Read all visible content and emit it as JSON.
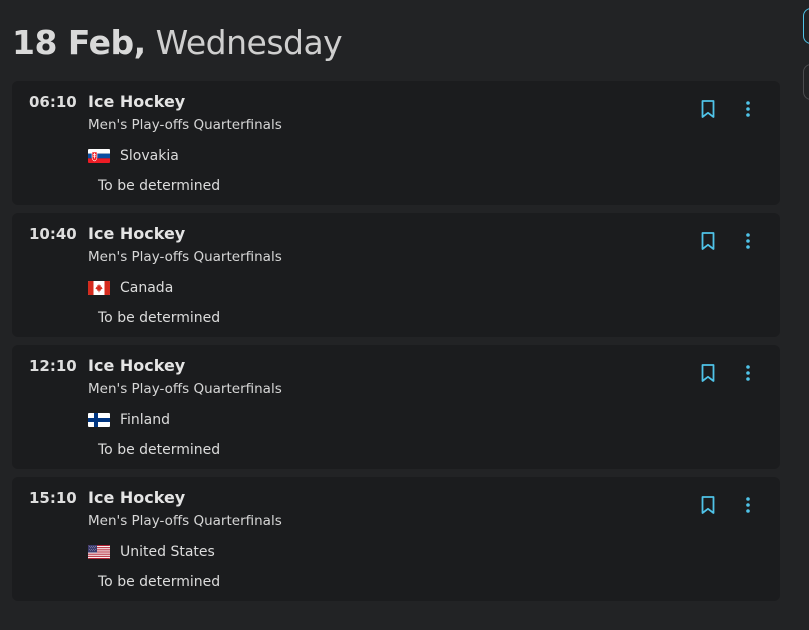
{
  "header": {
    "date": "18 Feb,",
    "weekday": "Wednesday"
  },
  "accent_color": "#4fc3e8",
  "events": [
    {
      "time": "06:10",
      "sport": "Ice Hockey",
      "phase": "Men's Play-offs Quarterfinals",
      "team": "Slovakia",
      "flag_icon": "slovakia-flag-icon",
      "opponent": "To be determined"
    },
    {
      "time": "10:40",
      "sport": "Ice Hockey",
      "phase": "Men's Play-offs Quarterfinals",
      "team": "Canada",
      "flag_icon": "canada-flag-icon",
      "opponent": "To be determined"
    },
    {
      "time": "12:10",
      "sport": "Ice Hockey",
      "phase": "Men's Play-offs Quarterfinals",
      "team": "Finland",
      "flag_icon": "finland-flag-icon",
      "opponent": "To be determined"
    },
    {
      "time": "15:10",
      "sport": "Ice Hockey",
      "phase": "Men's Play-offs Quarterfinals",
      "team": "United States",
      "flag_icon": "united-states-flag-icon",
      "opponent": "To be determined"
    }
  ]
}
